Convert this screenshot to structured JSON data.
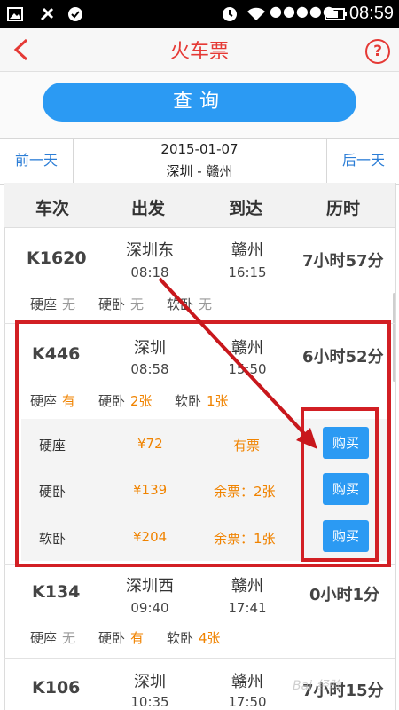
{
  "status_bar": {
    "time": "08:59",
    "signal_dots": "●●●●●"
  },
  "header": {
    "title": "火车票",
    "help_label": "?"
  },
  "query": {
    "button_label": "查询"
  },
  "date_bar": {
    "prev_label": "前一天",
    "date": "2015-01-07",
    "route": "深圳 - 赣州",
    "next_label": "后一天"
  },
  "columns": [
    "车次",
    "出发",
    "到达",
    "历时"
  ],
  "trains": [
    {
      "number": "K1620",
      "from": "深圳东",
      "depart": "08:18",
      "to": "赣州",
      "arrive": "16:15",
      "duration": "7小时57分",
      "seats": [
        {
          "type": "硬座",
          "avail": "无"
        },
        {
          "type": "硬卧",
          "avail": "无"
        },
        {
          "type": "软卧",
          "avail": "无"
        }
      ]
    },
    {
      "number": "K446",
      "from": "深圳",
      "depart": "08:58",
      "to": "赣州",
      "arrive": "15:50",
      "duration": "6小时52分",
      "seats": [
        {
          "type": "硬座",
          "avail": "有"
        },
        {
          "type": "硬卧",
          "avail": "2张"
        },
        {
          "type": "软卧",
          "avail": "1张"
        }
      ]
    },
    {
      "number": "K134",
      "from": "深圳西",
      "depart": "09:40",
      "to": "赣州",
      "arrive": "17:41",
      "duration": "0小时1分",
      "seats": [
        {
          "type": "硬座",
          "avail": "无"
        },
        {
          "type": "硬卧",
          "avail": "有"
        },
        {
          "type": "软卧",
          "avail": "4张"
        }
      ]
    },
    {
      "number": "K106",
      "from": "深圳",
      "depart": "10:35",
      "to": "赣州",
      "arrive": "17:50",
      "duration": "7小时15分"
    }
  ],
  "expanded": [
    {
      "seat": "硬座",
      "price": "¥72",
      "stock": "有票",
      "buy_label": "购买"
    },
    {
      "seat": "硬卧",
      "price": "¥139",
      "stock": "余票：2张",
      "buy_label": "购买"
    },
    {
      "seat": "软卧",
      "price": "¥204",
      "stock": "余票：1张",
      "buy_label": "购买"
    }
  ],
  "colors": {
    "accent_red": "#e53935",
    "button_blue": "#2b9af3",
    "link_blue": "#2b7dd6",
    "orange": "#f08300",
    "annotation_red": "#d21f24"
  }
}
